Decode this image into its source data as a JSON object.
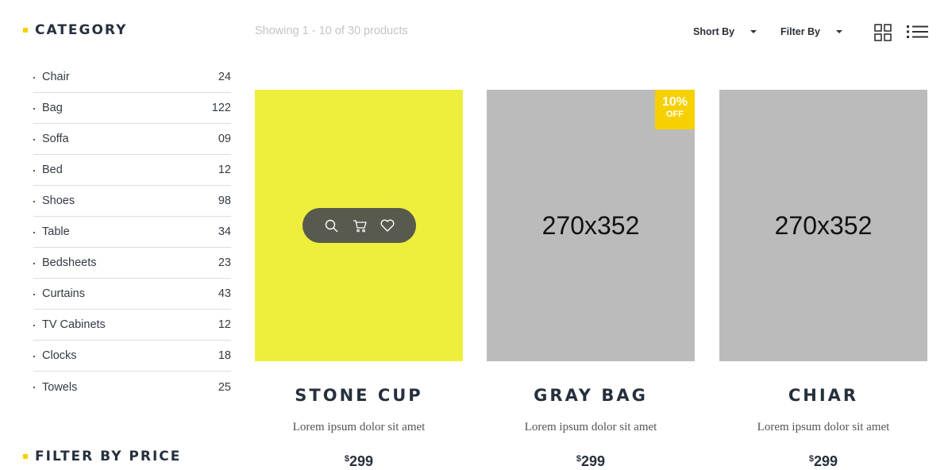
{
  "sidebar": {
    "category_heading": "CATEGORY",
    "price_heading": "FILTER BY PRICE",
    "categories": [
      {
        "name": "Chair",
        "count": "24"
      },
      {
        "name": "Bag",
        "count": "122"
      },
      {
        "name": "Soffa",
        "count": "09"
      },
      {
        "name": "Bed",
        "count": "12"
      },
      {
        "name": "Shoes",
        "count": "98"
      },
      {
        "name": "Table",
        "count": "34"
      },
      {
        "name": "Bedsheets",
        "count": "23"
      },
      {
        "name": "Curtains",
        "count": "43"
      },
      {
        "name": "TV Cabinets",
        "count": "12"
      },
      {
        "name": "Clocks",
        "count": "18"
      },
      {
        "name": "Towels",
        "count": "25"
      }
    ]
  },
  "toolbar": {
    "showing": "Showing 1 - 10 of 30 products",
    "sort_label": "Short By",
    "filter_label": "Filter By",
    "grid_icon": "grid-view-icon",
    "list_icon": "list-view-icon"
  },
  "products": [
    {
      "title": "STONE CUP",
      "desc": "Lorem ipsum dolor sit amet",
      "currency": "$",
      "price": "299",
      "image_color": "#eeee3c"
    },
    {
      "title": "GRAY BAG",
      "desc": "Lorem ipsum dolor sit amet",
      "currency": "$",
      "price": "299",
      "placeholder": "270x352",
      "badge_pct": "10%",
      "badge_off": "OFF"
    },
    {
      "title": "CHIAR",
      "desc": "Lorem ipsum dolor sit amet",
      "currency": "$",
      "price": "299",
      "placeholder": "270x352"
    }
  ],
  "colors": {
    "accent": "#f7d000",
    "heading": "#26303d",
    "placeholder_bg": "#bbbbbb"
  }
}
